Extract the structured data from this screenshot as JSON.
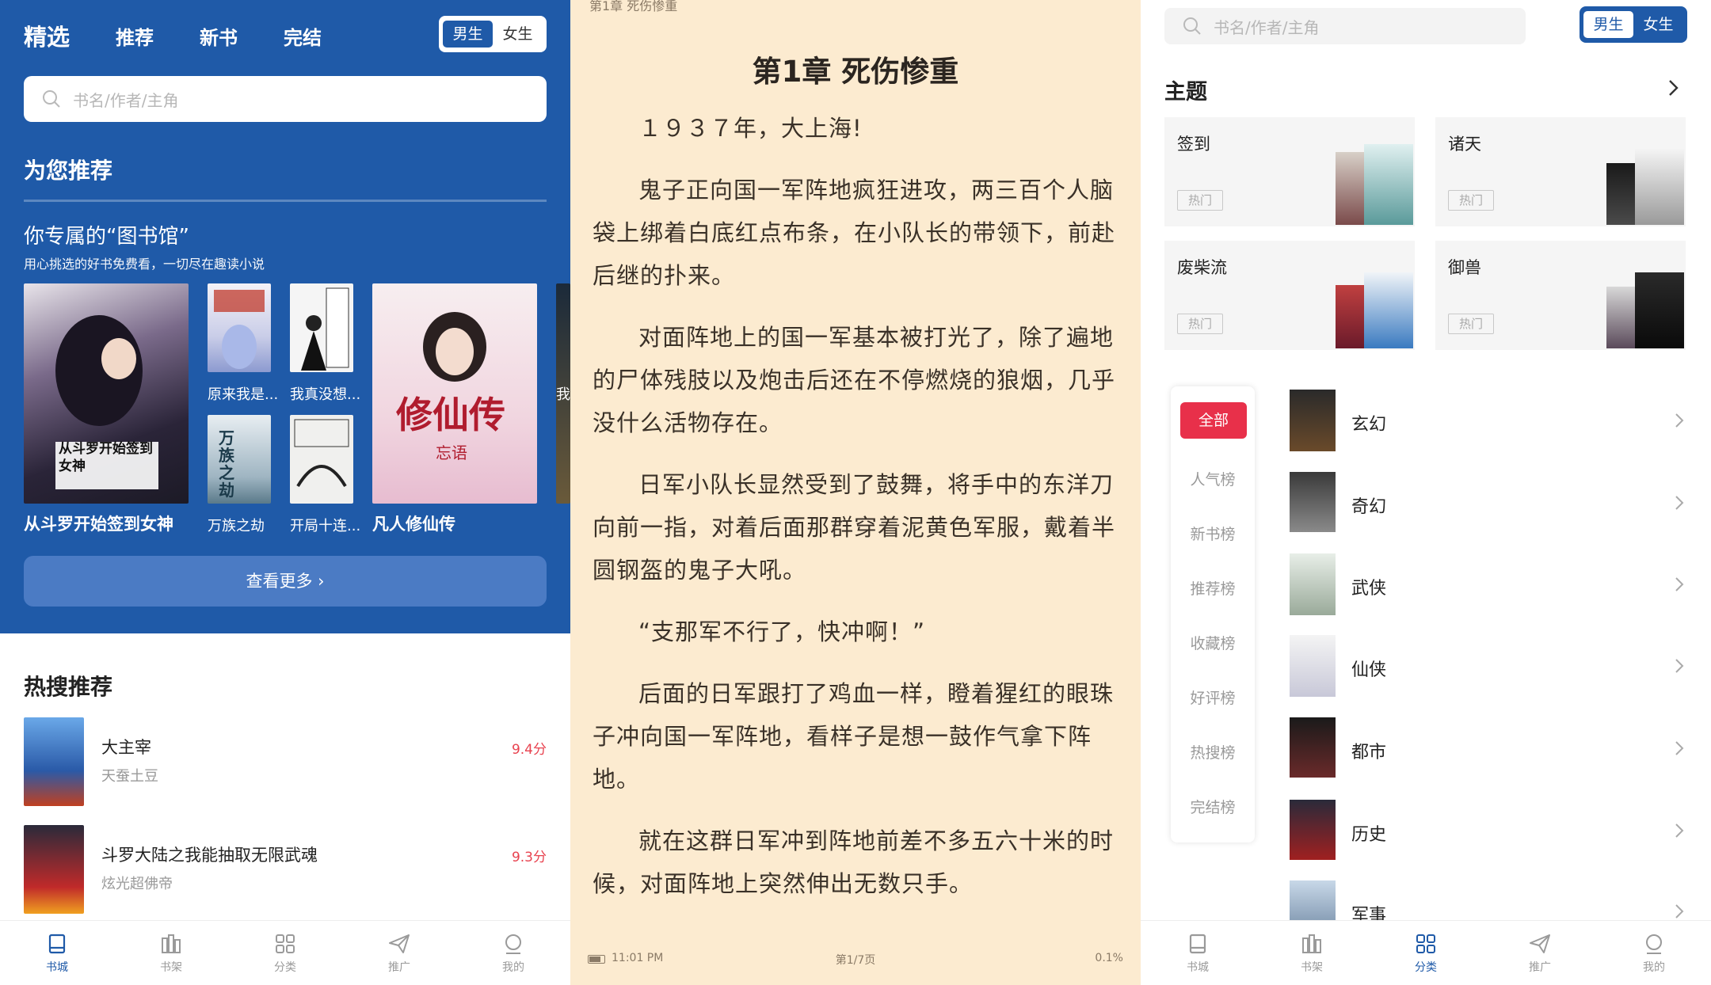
{
  "colors": {
    "brand_blue": "#1f5aa8",
    "paper": "#fcebd0",
    "score_red": "#e8424f",
    "active_red": "#e8304a"
  },
  "left": {
    "tabs": [
      "精选",
      "推荐",
      "新书",
      "完结"
    ],
    "gender": {
      "male": "男生",
      "female": "女生"
    },
    "search_placeholder": "书名/作者/主角",
    "recommend_title": "为您推荐",
    "library_title": "你专属的“图书馆”",
    "library_subtitle": "用心挑选的好书免费看，一切尽在趣读小说",
    "books": {
      "b1": "从斗罗开始签到女神",
      "b2": "原来我是...",
      "b3": "我真没想...",
      "b4": "万族之劫",
      "b5": "开局十连...",
      "b6": "凡人修仙传",
      "b7": "我"
    },
    "cover_texts": {
      "b6": "修仙传",
      "b6_author": "忘语",
      "b1": "从斗罗开始签到女神",
      "b4": "万族之劫"
    },
    "more_button": "查看更多 ›",
    "hot_title": "热搜推荐",
    "hot_items": [
      {
        "name": "大主宰",
        "author": "天蚕土豆",
        "score": "9.4分"
      },
      {
        "name": "斗罗大陆之我能抽取无限武魂",
        "author": "炫光超佛帝",
        "score": "9.3分"
      }
    ],
    "nav": [
      "书城",
      "书架",
      "分类",
      "推广",
      "我的"
    ]
  },
  "middle": {
    "chapter_top": "第1章 死伤惨重",
    "chapter_title": "第1章 死伤惨重",
    "paragraphs": [
      "１９３７年，大上海!",
      "鬼子正向国一军阵地疯狂进攻，两三百个人脑袋上绑着白底红点布条，在小队长的带领下，前赴后继的扑来。",
      "对面阵地上的国一军基本被打光了，除了遍地的尸体残肢以及炮击后还在不停燃烧的狼烟，几乎没什么活物存在。",
      "日军小队长显然受到了鼓舞，将手中的东洋刀向前一指，对着后面那群穿着泥黄色军服，戴着半圆钢盔的鬼子大吼。",
      "“支那军不行了，快冲啊！”",
      "后面的日军跟打了鸡血一样，瞪着猩红的眼珠子冲向国一军阵地，看样子是想一鼓作气拿下阵地。",
      "就在这群日军冲到阵地前差不多五六十米的时候，对面阵地上突然伸出无数只手。"
    ],
    "time": "11:01 PM",
    "page": "第1/7页",
    "progress": "0.1%"
  },
  "right": {
    "search_placeholder": "书名/作者/主角",
    "gender": {
      "male": "男生",
      "female": "女生"
    },
    "theme_title": "主题",
    "themes": [
      {
        "name": "签到",
        "tag": "热门"
      },
      {
        "name": "诸天",
        "tag": "热门"
      },
      {
        "name": "废柴流",
        "tag": "热门"
      },
      {
        "name": "御兽",
        "tag": "热门"
      }
    ],
    "ranks": [
      "全部",
      "人气榜",
      "新书榜",
      "推荐榜",
      "收藏榜",
      "好评榜",
      "热搜榜",
      "完结榜"
    ],
    "categories": [
      "玄幻",
      "奇幻",
      "武侠",
      "仙侠",
      "都市",
      "历史",
      "军事"
    ],
    "nav": [
      "书城",
      "书架",
      "分类",
      "推广",
      "我的"
    ]
  }
}
